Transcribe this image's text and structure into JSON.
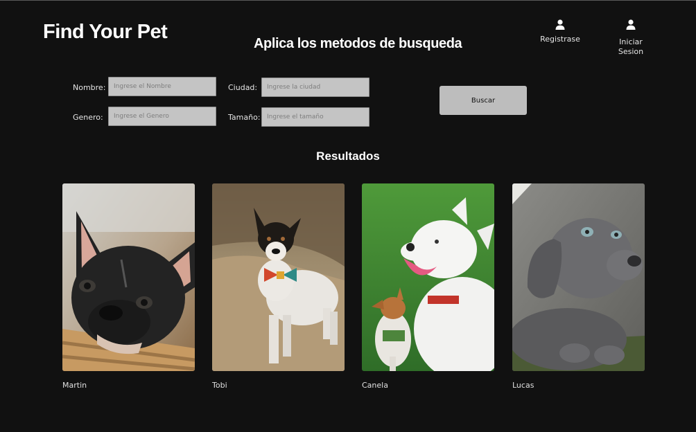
{
  "header": {
    "brand": "Find Your Pet",
    "headline": "Aplica los metodos de busqueda",
    "register_label": "Registrase",
    "login_label": "Iniciar Sesion"
  },
  "search": {
    "nombre_label": "Nombre:",
    "nombre_placeholder": "Ingrese el Nombre",
    "ciudad_label": "Ciudad:",
    "ciudad_placeholder": "Ingrese la ciudad",
    "genero_label": "Genero:",
    "genero_placeholder": "Ingrese el Genero",
    "tamano_label": "Tamaño:",
    "tamano_placeholder": "Ingrese el tamaño",
    "button_label": "Buscar"
  },
  "results": {
    "title": "Resultados",
    "pets": [
      {
        "name": "Martin",
        "photo": "french-bulldog-photo"
      },
      {
        "name": "Tobi",
        "photo": "terrier-with-bowtie-photo"
      },
      {
        "name": "Canela",
        "photo": "two-dogs-on-grass-photo"
      },
      {
        "name": "Lucas",
        "photo": "weimaraner-puppy-photo"
      }
    ]
  },
  "icons": {
    "register": "user-icon",
    "login": "user-icon"
  },
  "colors": {
    "background": "#111111",
    "input_bg": "#c4c4c4",
    "button_bg": "#bdbdbd"
  }
}
